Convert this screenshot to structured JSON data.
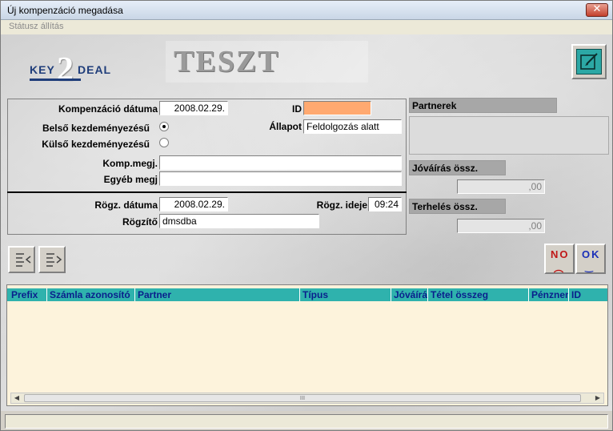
{
  "window": {
    "title": "Új kompenzáció megadása",
    "close_label": "✕"
  },
  "menu": {
    "item": "Státusz állítás"
  },
  "branding": {
    "logo_key": "KEY",
    "logo_two": "2",
    "logo_deal": "DEAL",
    "banner": "TESZT"
  },
  "form": {
    "komp_datum_label": "Kompenzáció dátuma",
    "komp_datum_value": "2008.02.29.",
    "id_label": "ID",
    "id_value": "",
    "belso_label": "Belső kezdeményezésű",
    "belso_selected": true,
    "kulso_label": "Külső kezdeményezésű",
    "kulso_selected": false,
    "allapot_label": "Állapot",
    "allapot_value": "Feldolgozás alatt",
    "komp_megj_label": "Komp.megj.",
    "komp_megj_value": "",
    "egyeb_megj_label": "Egyéb megj",
    "egyeb_megj_value": "",
    "rogz_datum_label": "Rögz. dátuma",
    "rogz_datum_value": "2008.02.29.",
    "rogz_ideje_label": "Rögz. ideje",
    "rogz_ideje_value": "09:24",
    "rogzito_label": "Rögzítő",
    "rogzito_value": "dmsdba"
  },
  "right_panel": {
    "partnerek_label": "Partnerek",
    "joviras_label": "Jóváírás össz.",
    "joviras_value": ",00",
    "terheles_label": "Terhelés össz.",
    "terheles_value": ",00"
  },
  "buttons": {
    "no_label": "NO",
    "ok_label": "OK",
    "no_face": "︵",
    "ok_face": "‿"
  },
  "grid": {
    "columns": [
      "Prefix",
      "Számla azonosító",
      "Partner",
      "Típus",
      "Jóváírás",
      "Tétel összeg",
      "Pénznem",
      "ID"
    ],
    "rows": [],
    "scroll_thumb_label": "III"
  },
  "colors": {
    "accent_teal": "#2fb2ad",
    "id_field": "#ffa970",
    "grid_bg": "#fdf3dc"
  }
}
